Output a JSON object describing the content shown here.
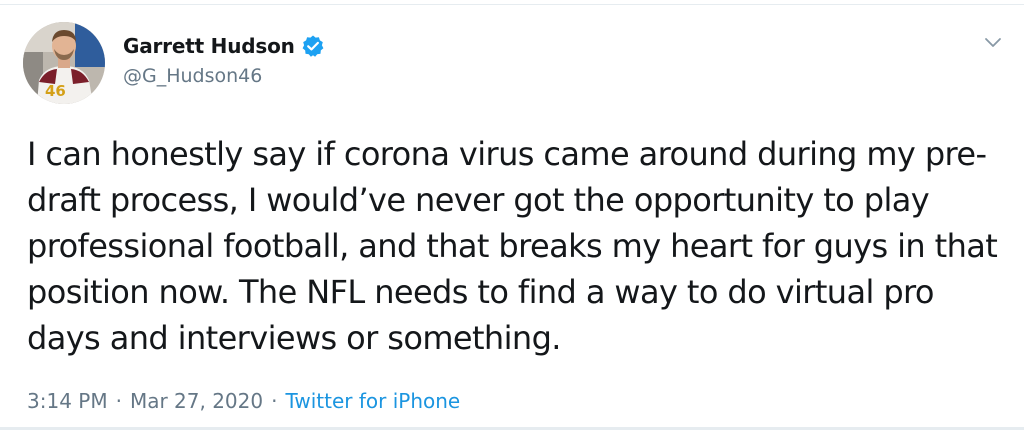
{
  "user": {
    "display_name": "Garrett Hudson",
    "handle": "@G_Hudson46",
    "verified": true,
    "avatar_jersey_number": "46"
  },
  "tweet": {
    "text": "I can honestly say if corona virus came around during my pre-draft process, I would’ve never got the opportunity to play professional football, and that breaks my heart for guys in that position now. The NFL needs to find a way to do virtual pro days and interviews or something.",
    "time": "3:14 PM",
    "separator": "·",
    "date": "Mar 27, 2020",
    "source": "Twitter for iPhone"
  },
  "icons": {
    "verified": "verified-badge-icon",
    "menu": "chevron-down-icon"
  },
  "colors": {
    "text_primary": "#14171a",
    "text_secondary": "#657786",
    "link": "#1b95e0",
    "verified_blue": "#1da1f2"
  }
}
